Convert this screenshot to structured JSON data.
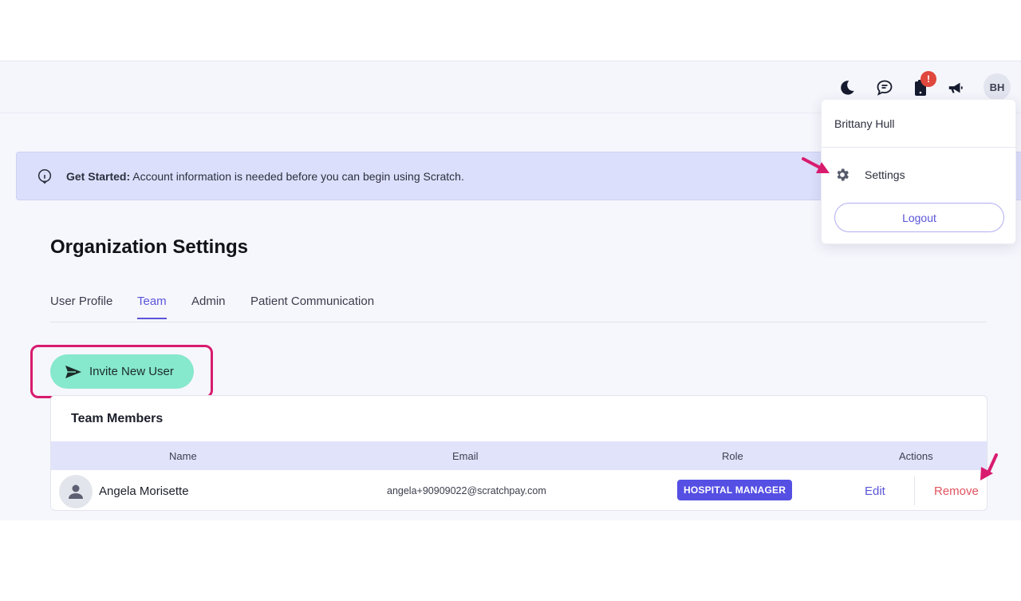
{
  "header": {
    "avatar_initials": "BH",
    "notification_badge": "!",
    "icons": [
      "moon-icon",
      "chat-icon",
      "clipboard-icon",
      "megaphone-icon"
    ]
  },
  "banner": {
    "label": "Get Started:",
    "message": "Account information is needed before you can begin using Scratch."
  },
  "page": {
    "title": "Organization Settings"
  },
  "tabs": [
    {
      "label": "User Profile",
      "active": false
    },
    {
      "label": "Team",
      "active": true
    },
    {
      "label": "Admin",
      "active": false
    },
    {
      "label": "Patient Communication",
      "active": false
    }
  ],
  "invite_button": {
    "label": "Invite New User"
  },
  "team_members": {
    "title": "Team Members",
    "columns": [
      "Name",
      "Email",
      "Role",
      "Actions"
    ],
    "rows": [
      {
        "name": "Angela Morisette",
        "email": "angela+90909022@scratchpay.com",
        "role": "HOSPITAL MANAGER",
        "edit_label": "Edit",
        "remove_label": "Remove"
      }
    ]
  },
  "user_menu": {
    "user_name": "Brittany Hull",
    "settings_label": "Settings",
    "logout_label": "Logout"
  },
  "colors": {
    "accent": "#5a55d9",
    "invite_button": "#86e8cd",
    "banner_bg": "#dcdffb",
    "remove": "#e0545e",
    "annotation": "#d81b6f",
    "badge": "#e0473d"
  }
}
